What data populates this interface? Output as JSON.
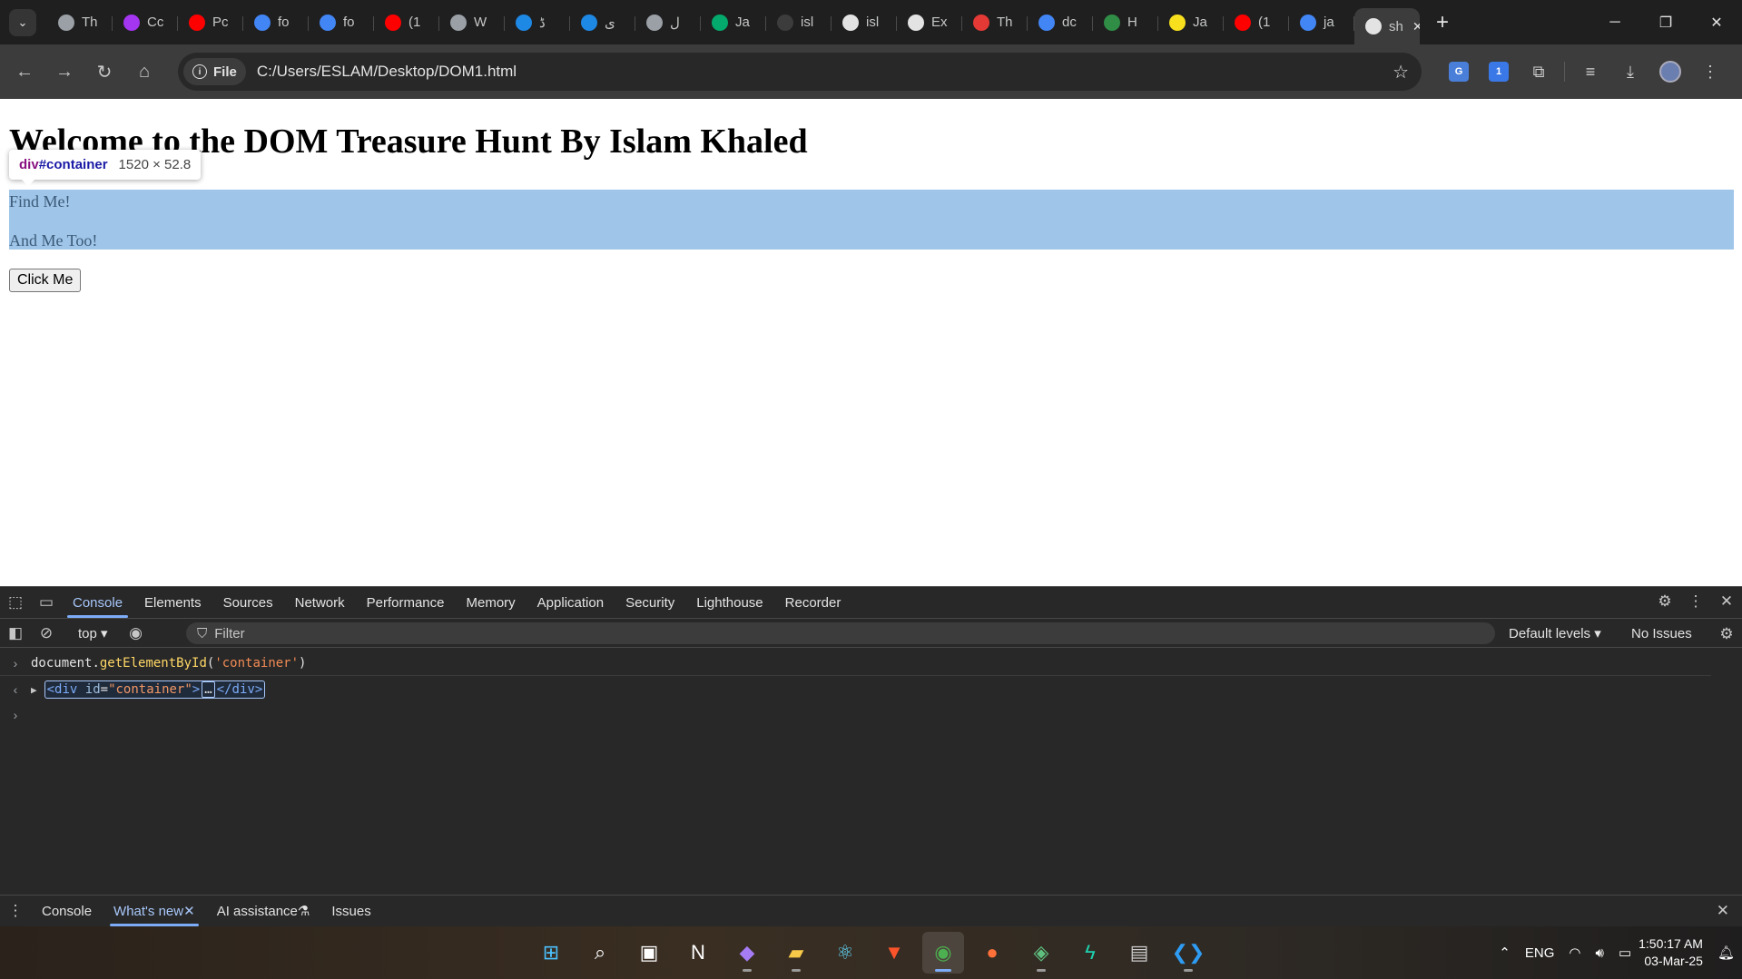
{
  "browser": {
    "tabs": [
      {
        "title": "Th",
        "icon": "globe-icon",
        "color": "#9aa0a6"
      },
      {
        "title": "Cc",
        "icon": "udemy-icon",
        "color": "#a435f0"
      },
      {
        "title": "Pc",
        "icon": "youtube-icon",
        "color": "#ff0000"
      },
      {
        "title": "fo",
        "icon": "google-icon",
        "color": "#4285f4"
      },
      {
        "title": "fo",
        "icon": "google-icon",
        "color": "#4285f4"
      },
      {
        "title": "(1",
        "icon": "youtube-icon",
        "color": "#ff0000"
      },
      {
        "title": "W",
        "icon": "search-icon",
        "color": "#9aa0a6"
      },
      {
        "title": "ڈ",
        "icon": "e-icon",
        "color": "#1e88e5"
      },
      {
        "title": "ى",
        "icon": "e-icon",
        "color": "#1e88e5"
      },
      {
        "title": "ل",
        "icon": "openai-icon",
        "color": "#9aa0a6"
      },
      {
        "title": "Ja",
        "icon": "w3schools-icon",
        "color": "#04aa6d"
      },
      {
        "title": "isl",
        "icon": "loading-icon",
        "color": "#3c3c3c"
      },
      {
        "title": "isl",
        "icon": "github-icon",
        "color": "#e3e3e3"
      },
      {
        "title": "Ex",
        "icon": "medium-icon",
        "color": "#e3e3e3"
      },
      {
        "title": "Th",
        "icon": "pin-icon",
        "color": "#e53935"
      },
      {
        "title": "dc",
        "icon": "google-icon",
        "color": "#4285f4"
      },
      {
        "title": "H",
        "icon": "gfg-icon",
        "color": "#2f8d46"
      },
      {
        "title": "Ja",
        "icon": "js-icon",
        "color": "#f7df1e"
      },
      {
        "title": "(1",
        "icon": "youtube-icon",
        "color": "#ff0000"
      },
      {
        "title": "ja",
        "icon": "google-icon",
        "color": "#4285f4"
      },
      {
        "title": "sh",
        "icon": "github-icon",
        "color": "#e3e3e3"
      }
    ],
    "active_tab_close": "✕",
    "new_tab": "+",
    "chip_label": "File",
    "url": "C:/Users/ESLAM/Desktop/DOM1.html",
    "ext_badge_count": "1"
  },
  "page": {
    "heading": "Welcome to the DOM Treasure Hunt By Islam Khaled",
    "para1": "Find Me!",
    "para2": "And Me Too!",
    "button": "Click Me",
    "tooltip": {
      "tag": "div",
      "id": "#container",
      "size": "1520 × 52.8"
    }
  },
  "devtools": {
    "tabs": [
      "Console",
      "Elements",
      "Sources",
      "Network",
      "Performance",
      "Memory",
      "Application",
      "Security",
      "Lighthouse",
      "Recorder"
    ],
    "active_tab": "Console",
    "context": "top ▾",
    "filter_placeholder": "Filter",
    "levels": "Default levels ▾",
    "issues": "No Issues",
    "console": {
      "input_obj": "document",
      "input_method": "getElementById",
      "input_arg": "'container'",
      "output_open": "<div",
      "output_attr_name": "id",
      "output_attr_value": "\"container\"",
      "output_ellipsis": "…",
      "output_close": "</div>"
    },
    "drawer_tabs": [
      "Console",
      "What's new",
      "AI assistance",
      "Issues"
    ],
    "drawer_active": "What's new"
  },
  "taskbar": {
    "apps": [
      "windows-start-icon",
      "search-icon",
      "task-view-icon",
      "notion-icon",
      "obsidian-icon",
      "file-explorer-icon",
      "react-icon",
      "brave-icon",
      "chrome-icon",
      "firefox-icon",
      "git-icon",
      "bolt-icon",
      "terminal-icon",
      "vscode-icon"
    ],
    "language": "ENG",
    "time": "1:50:17 AM",
    "date": "03-Mar-25"
  }
}
